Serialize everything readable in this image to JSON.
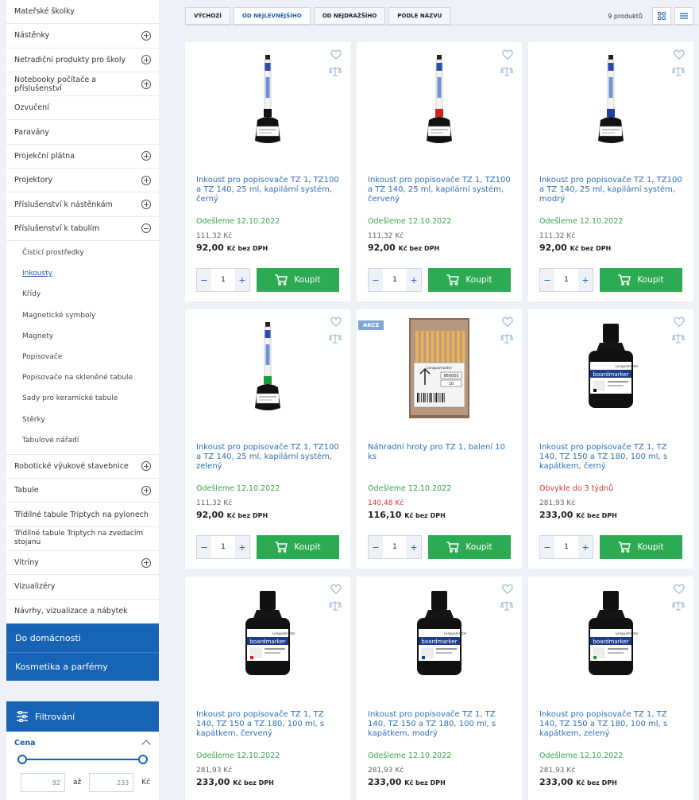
{
  "categories_top": [
    {
      "label": "Mateřské školky",
      "expand": false
    },
    {
      "label": "Nástěnky",
      "expand": true
    },
    {
      "label": "Netradiční produkty pro školy",
      "expand": true
    },
    {
      "label": "Notebooky počítače a příslušenství",
      "expand": true
    },
    {
      "label": "Ozvučení",
      "expand": false
    },
    {
      "label": "Paravány",
      "expand": false
    },
    {
      "label": "Projekční plátna",
      "expand": true
    },
    {
      "label": "Projektory",
      "expand": true
    },
    {
      "label": "Příslušenství k nástěnkám",
      "expand": true
    },
    {
      "label": "Příslušenství k tabulím",
      "expand": "open"
    }
  ],
  "subcategories": [
    "Čisticí prostředky",
    "Inkousty",
    "Křídy",
    "Magnetické symboly",
    "Magnety",
    "Popisovače",
    "Popisovače na skleněné tabule",
    "Sady pro keramické tabule",
    "Stěrky",
    "Tabulové nářadí"
  ],
  "categories_bottom": [
    {
      "label": "Robotické výukové stavebnice",
      "expand": true
    },
    {
      "label": "Tabule",
      "expand": true
    },
    {
      "label": "Třídílné tabule Triptych na pylonech",
      "expand": false
    },
    {
      "label": "Třídílné tabule Triptych na zvedacím stojanu",
      "expand": false
    },
    {
      "label": "Vitríny",
      "expand": true
    },
    {
      "label": "Vizualizéry",
      "expand": false
    },
    {
      "label": "Návrhy, vizualizace a nábytek",
      "expand": false
    }
  ],
  "blue_categories": [
    "Do domácnosti",
    "Kosmetika a parfémy"
  ],
  "filter": {
    "title": "Filtrování",
    "price_label": "Cena",
    "min": "92",
    "max": "233",
    "between": "až",
    "currency": "Kč"
  },
  "sort_tabs": [
    "VÝCHOZÍ",
    "OD NEJLEVNĚJŠÍHO",
    "OD NEJDRAŽŠÍHO",
    "PODLE NÁZVU"
  ],
  "product_count": "9 produktů",
  "buy_label": "Koupit",
  "price_unit": "Kč bez DPH",
  "products": [
    {
      "name": "Inkoust pro popisovače TZ 1, TZ100 a TZ 140, 25 ml, kapilární systém, černý",
      "availability": "Odešleme 12.10.2022",
      "avail_red": false,
      "old_price": "111,32 Kč",
      "old_red": false,
      "price": "92,00",
      "qty": "1",
      "badge": "",
      "image": "marker",
      "color": "#111111"
    },
    {
      "name": "Inkoust pro popisovače TZ 1, TZ100 a TZ 140, 25 ml, kapilární systém, červený",
      "availability": "Odešleme 12.10.2022",
      "avail_red": false,
      "old_price": "111,32 Kč",
      "old_red": false,
      "price": "92,00",
      "qty": "1",
      "badge": "",
      "image": "marker",
      "color": "#d42020"
    },
    {
      "name": "Inkoust pro popisovače TZ 1, TZ100 a TZ 140, 25 ml, kapilární systém, modrý",
      "availability": "Odešleme 12.10.2022",
      "avail_red": false,
      "old_price": "111,32 Kč",
      "old_red": false,
      "price": "92,00",
      "qty": "1",
      "badge": "",
      "image": "marker",
      "color": "#1c3fa6"
    },
    {
      "name": "Inkoust pro popisovače TZ 1, TZ100 a TZ 140, 25 ml, kapilární systém, zelený",
      "availability": "Odešleme 12.10.2022",
      "avail_red": false,
      "old_price": "111,32 Kč",
      "old_red": false,
      "price": "92,00",
      "qty": "1",
      "badge": "",
      "image": "marker",
      "color": "#1f9a3a"
    },
    {
      "name": "Náhradní hroty pro TZ 1, balení 10 ks",
      "availability": "Odešleme 12.10.2022",
      "avail_red": false,
      "old_price": "140,48 Kč",
      "old_red": true,
      "price": "116,10",
      "qty": "1",
      "badge": "AKCE",
      "image": "pack",
      "color": "#e8a54a"
    },
    {
      "name": "Inkoust pro popisovače TZ 1, TZ 140, TZ 150 a TZ 180, 100 ml, s kapátkem, černý",
      "availability": "Obvykle do 3 týdnů",
      "avail_red": true,
      "old_price": "281,93 Kč",
      "old_red": false,
      "price": "233,00",
      "qty": "1",
      "badge": "",
      "image": "bottle",
      "color": "#111111"
    },
    {
      "name": "Inkoust pro popisovače TZ 1, TZ 140, TZ 150 a TZ 180, 100 ml, s kapátkem, červený",
      "availability": "Odešleme 12.10.2022",
      "avail_red": false,
      "old_price": "281,93 Kč",
      "old_red": false,
      "price": "233,00",
      "qty": "1",
      "badge": "",
      "image": "bottle",
      "color": "#d42020"
    },
    {
      "name": "Inkoust pro popisovače TZ 1, TZ 140, TZ 150 a TZ 180, 100 ml, s kapátkem, modrý",
      "availability": "Odešleme 12.10.2022",
      "avail_red": false,
      "old_price": "281,93 Kč",
      "old_red": false,
      "price": "233,00",
      "qty": "1",
      "badge": "",
      "image": "bottle",
      "color": "#1c3fa6"
    },
    {
      "name": "Inkoust pro popisovače TZ 1, TZ 140, TZ 150 a TZ 180, 100 ml, s kapátkem, zelený",
      "availability": "Odešleme 12.10.2022",
      "avail_red": false,
      "old_price": "281,93 Kč",
      "old_red": false,
      "price": "233,00",
      "qty": "1",
      "badge": "",
      "image": "bottle",
      "color": "#1f9a3a"
    }
  ],
  "image_labels": {
    "marker_brand": "Lenguamaster",
    "bottle_brand": "Lenguamaster",
    "bottle_product": "boardmarker",
    "pack_code": "860050",
    "pack_qty": "10"
  }
}
